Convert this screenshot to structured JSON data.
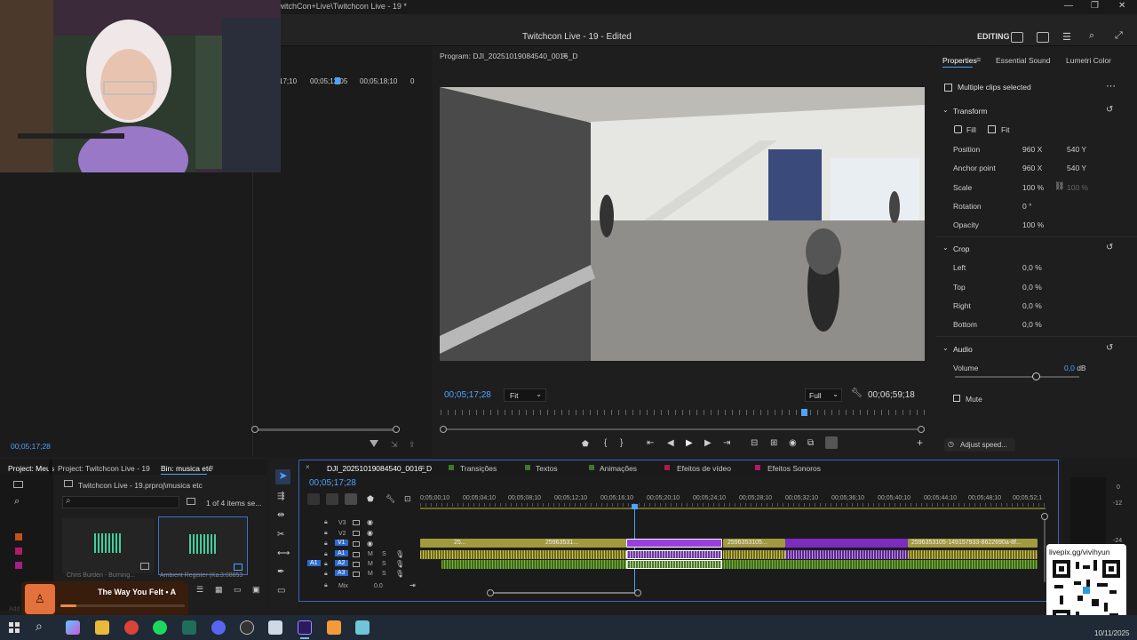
{
  "window": {
    "title": "Adobe Premiere Pro 2025 - V:\\> TIKTOK\\Twitch Con\\Dia 19 DOMINGO - TwitchCon+Live\\Twitchcon Live - 19 *",
    "sequence_title": "Twitchcon Live - 19",
    "edit_state": "Edited",
    "workspace": "EDITING"
  },
  "source": {
    "timecodes": [
      "17;10",
      "00;05;12;05",
      "00;05;18;10",
      "0"
    ],
    "current_time": "00;05;17;28"
  },
  "program": {
    "label": "Program: DJI_20251019084540_0016_D",
    "timecode": "00;05;17;28",
    "fit": "Fit",
    "quality": "Full",
    "duration": "00;06;59;18"
  },
  "properties": {
    "tabs": [
      "Properties",
      "Essential Sound",
      "Lumetri Color"
    ],
    "selection": "Multiple clips selected",
    "transform": {
      "label": "Transform",
      "fill": "Fill",
      "fit": "Fit",
      "position": {
        "label": "Position",
        "x": "960",
        "y": "540"
      },
      "anchor": {
        "label": "Anchor point",
        "x": "960",
        "y": "540"
      },
      "scale": {
        "label": "Scale",
        "value": "100",
        "value2": "100"
      },
      "rotation": {
        "label": "Rotation",
        "value": "0"
      },
      "opacity": {
        "label": "Opacity",
        "value": "100"
      }
    },
    "crop": {
      "label": "Crop",
      "left": {
        "label": "Left",
        "value": "0,0"
      },
      "top": {
        "label": "Top",
        "value": "0,0"
      },
      "right": {
        "label": "Right",
        "value": "0,0"
      },
      "bottom": {
        "label": "Bottom",
        "value": "0,0"
      }
    },
    "audio": {
      "label": "Audio",
      "volume_label": "Volume",
      "volume_value": "0,0",
      "volume_unit": "dB",
      "mute": "Mute"
    },
    "adjust_speed": "Adjust speed..."
  },
  "project": {
    "tabs": [
      "Project: Meus",
      "Project: Twitchcon Live - 19",
      "Bin: musica etc"
    ],
    "path": "Twitchcon Live - 19.prproj\\musica etc",
    "count": "1 of 4 items se...",
    "items": [
      {
        "name": "Chris Burden - Burning..."
      },
      {
        "name": "Ambient Register (Ka...",
        "duration": "3:08853"
      }
    ],
    "media_popup": "The Way You Felt • A",
    "faded": "Add Media Editing Media"
  },
  "timeline": {
    "tabs": [
      "DJI_20251019084540_0016_D",
      "Transições",
      "Textos",
      "Animações",
      "Efeitos de vídeo",
      "Efeitos Sonoros"
    ],
    "timecode": "00;05;17;28",
    "ruler": [
      "0;05;00;10",
      "00;05;04;10",
      "00;05;08;10",
      "00;05;12;10",
      "00;05;16;10",
      "00;05;20;10",
      "00;05;24;10",
      "00;05;28;10",
      "00;05;32;10",
      "00;05;36;10",
      "00;05;40;10",
      "00;05;44;10",
      "00;05;48;10",
      "00;05;52;1"
    ],
    "tracks": [
      "V3",
      "V2",
      "V1",
      "A1",
      "A2",
      "A3"
    ],
    "mix_label": "Mix",
    "mix_value": "0.0",
    "source_patch": "A1",
    "clip_labels": [
      "25...",
      "25963531...",
      "2596353105...",
      "2596353105-149157933-8622690a-8f..."
    ]
  },
  "meter": {
    "ticks": [
      "0",
      "-12",
      "-24"
    ]
  },
  "overlay": {
    "qr_label": "livepix.gg/vivihyun"
  },
  "taskbar": {
    "date": "10/11/2025"
  },
  "colors": {
    "accent": "#4da3ff",
    "v1clip": "#a29a3f",
    "purpleclip": "#9b3ee0",
    "audioyellow": "#c9c34a",
    "audiogreen": "#5a8f2e"
  }
}
